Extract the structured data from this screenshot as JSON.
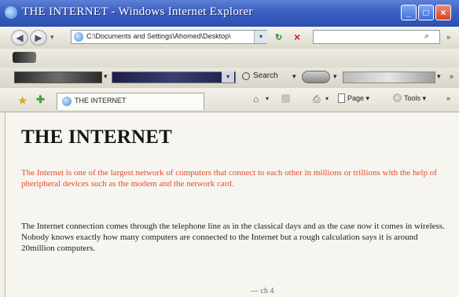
{
  "window": {
    "title": "THE INTERNET - Windows Internet Explorer",
    "title_bar_color": "#3b5fc2"
  },
  "address_bar": {
    "url": "C:\\Documents and Settings\\Ahomed\\Desktop\\"
  },
  "toolbar": {
    "search_label": "Search"
  },
  "tabs": [
    {
      "label": "THE INTERNET"
    }
  ],
  "command_bar": {
    "page_label": "Page",
    "tools_label": "Tools"
  },
  "content": {
    "heading": "THE INTERNET",
    "paragraph_red": "The Internet is one of the largest network of computers that connect to each other in millions or trillions with the help of pheripheral devices such as the modem and the network card.",
    "paragraph_red_color": "#e24a2e",
    "paragraph_black_1": "The Internet connection comes through the telephone line as in the classical days and as the case now it comes in wireless.",
    "paragraph_black_2": "Nobody knows exactly how many computers are connected to the Internet but a rough calculation says it is around 20million computers.",
    "footer_fragment": "— ch 4"
  }
}
